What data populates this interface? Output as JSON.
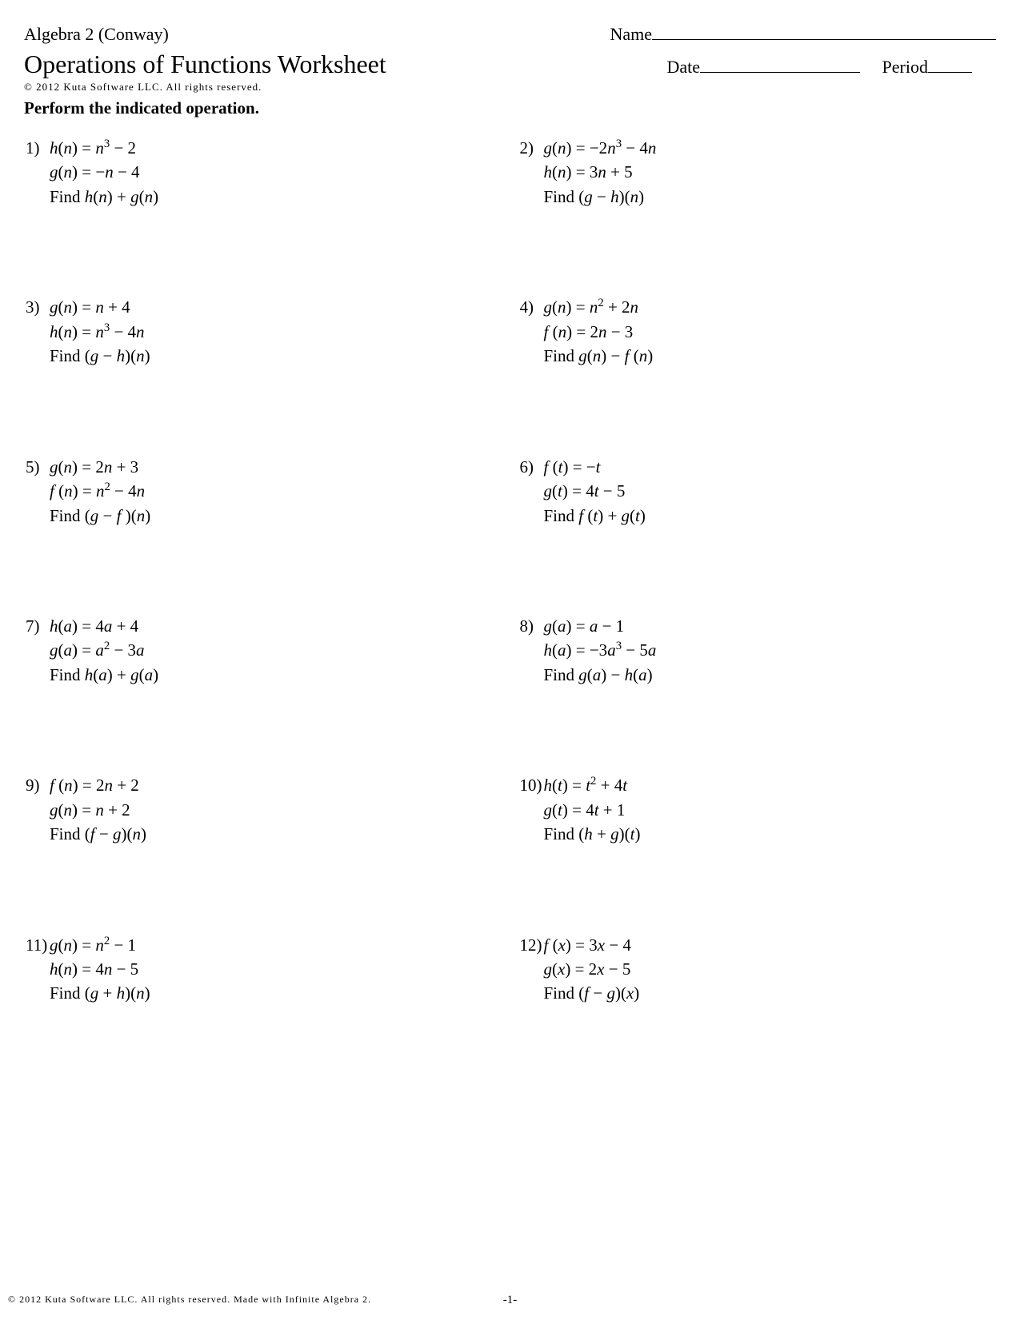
{
  "header": {
    "course": "Algebra 2 (Conway)",
    "name_label": "Name",
    "title": "Operations of Functions Worksheet",
    "date_label": "Date",
    "period_label": "Period",
    "copyright": "© 2012 Kuta Software LLC. All rights reserved.",
    "instruction": "Perform the indicated operation."
  },
  "problems": [
    {
      "n": "1)",
      "l1": "h(n) = n³ − 2",
      "l2": "g(n) = −n − 4",
      "find": "Find h(n) + g(n)"
    },
    {
      "n": "2)",
      "l1": "g(n) = −2n³ − 4n",
      "l2": "h(n) = 3n + 5",
      "find": "Find (g − h)(n)"
    },
    {
      "n": "3)",
      "l1": "g(n) = n + 4",
      "l2": "h(n) = n³ − 4n",
      "find": "Find (g − h)(n)"
    },
    {
      "n": "4)",
      "l1": "g(n) = n² + 2n",
      "l2": "f (n) = 2n − 3",
      "find": "Find g(n) − f (n)"
    },
    {
      "n": "5)",
      "l1": "g(n) = 2n + 3",
      "l2": "f (n) = n² − 4n",
      "find": "Find (g − f )(n)"
    },
    {
      "n": "6)",
      "l1": "f (t) = −t",
      "l2": "g(t) = 4t − 5",
      "find": "Find f (t) + g(t)"
    },
    {
      "n": "7)",
      "l1": "h(a) = 4a + 4",
      "l2": "g(a) = a² − 3a",
      "find": "Find h(a) + g(a)"
    },
    {
      "n": "8)",
      "l1": "g(a) = a − 1",
      "l2": "h(a) = −3a³ − 5a",
      "find": "Find g(a) − h(a)"
    },
    {
      "n": "9)",
      "l1": "f (n) = 2n + 2",
      "l2": "g(n) = n + 2",
      "find": "Find (f − g)(n)"
    },
    {
      "n": "10)",
      "l1": "h(t) = t² + 4t",
      "l2": "g(t) = 4t + 1",
      "find": "Find (h + g)(t)"
    },
    {
      "n": "11)",
      "l1": "g(n) = n² − 1",
      "l2": "h(n) = 4n − 5",
      "find": "Find (g + h)(n)"
    },
    {
      "n": "12)",
      "l1": "f (x) = 3x − 4",
      "l2": "g(x) = 2x − 5",
      "find": "Find (f − g)(x)"
    }
  ],
  "footer": {
    "copyright": "© 2012 Kuta Software LLC. All rights reserved. Made with Infinite Algebra 2.",
    "page": "-1-"
  }
}
